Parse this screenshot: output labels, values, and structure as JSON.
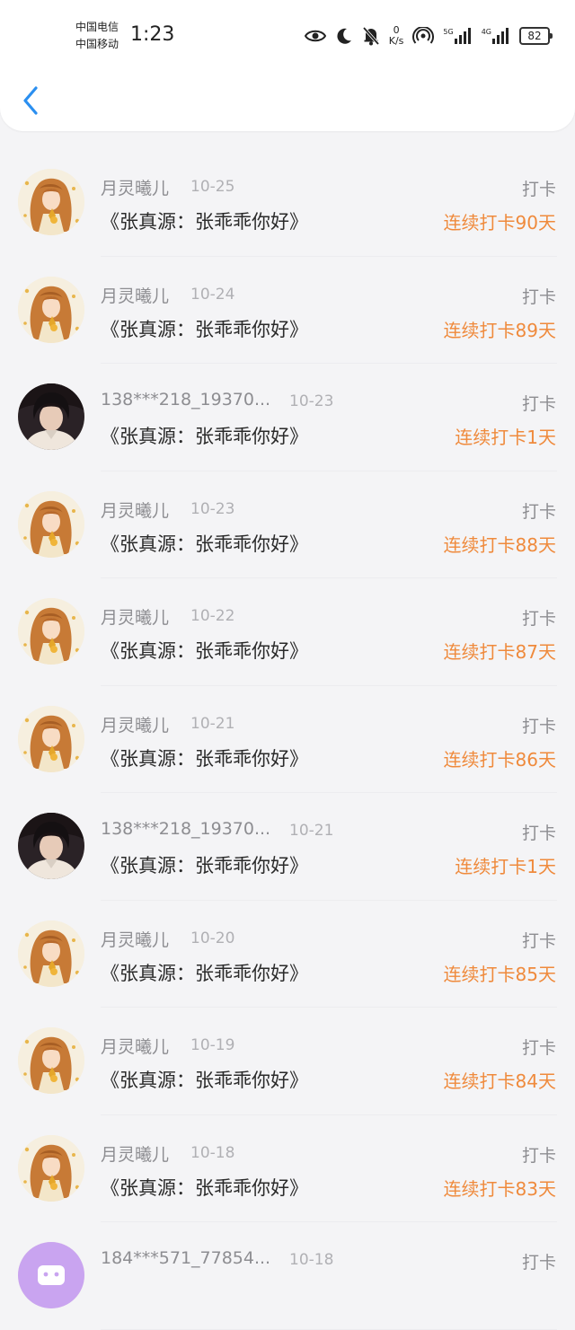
{
  "status_bar": {
    "carrier_1": "中国电信",
    "carrier_2": "中国移动",
    "time": "1:23",
    "net_speed_value": "0",
    "net_speed_unit": "K/s",
    "signal_1_label": "5G",
    "signal_2_label": "4G",
    "battery": "82",
    "icons": [
      "eye-icon",
      "moon-icon",
      "bell-off-icon",
      "hotspot-icon",
      "signal-icon",
      "battery-icon"
    ]
  },
  "header": {
    "back_icon": "chevron-left-icon"
  },
  "colors": {
    "streak": "#ef8a3c",
    "back": "#2b8ff0"
  },
  "records": [
    {
      "name": "月灵曦儿",
      "date": "10-25",
      "title": "《张真源：张乖乖你好》",
      "tag": "打卡",
      "streak": "连续打卡90天",
      "avatar": "girl"
    },
    {
      "name": "月灵曦儿",
      "date": "10-24",
      "title": "《张真源：张乖乖你好》",
      "tag": "打卡",
      "streak": "连续打卡89天",
      "avatar": "girl"
    },
    {
      "name": "138***218_19370...",
      "date": "10-23",
      "title": "《张真源：张乖乖你好》",
      "tag": "打卡",
      "streak": "连续打卡1天",
      "avatar": "dark"
    },
    {
      "name": "月灵曦儿",
      "date": "10-23",
      "title": "《张真源：张乖乖你好》",
      "tag": "打卡",
      "streak": "连续打卡88天",
      "avatar": "girl"
    },
    {
      "name": "月灵曦儿",
      "date": "10-22",
      "title": "《张真源：张乖乖你好》",
      "tag": "打卡",
      "streak": "连续打卡87天",
      "avatar": "girl"
    },
    {
      "name": "月灵曦儿",
      "date": "10-21",
      "title": "《张真源：张乖乖你好》",
      "tag": "打卡",
      "streak": "连续打卡86天",
      "avatar": "girl"
    },
    {
      "name": "138***218_19370...",
      "date": "10-21",
      "title": "《张真源：张乖乖你好》",
      "tag": "打卡",
      "streak": "连续打卡1天",
      "avatar": "dark"
    },
    {
      "name": "月灵曦儿",
      "date": "10-20",
      "title": "《张真源：张乖乖你好》",
      "tag": "打卡",
      "streak": "连续打卡85天",
      "avatar": "girl"
    },
    {
      "name": "月灵曦儿",
      "date": "10-19",
      "title": "《张真源：张乖乖你好》",
      "tag": "打卡",
      "streak": "连续打卡84天",
      "avatar": "girl"
    },
    {
      "name": "月灵曦儿",
      "date": "10-18",
      "title": "《张真源：张乖乖你好》",
      "tag": "打卡",
      "streak": "连续打卡83天",
      "avatar": "girl"
    },
    {
      "name": "184***571_77854...",
      "date": "10-18",
      "title": "",
      "tag": "打卡",
      "streak": "",
      "avatar": "purple"
    }
  ]
}
